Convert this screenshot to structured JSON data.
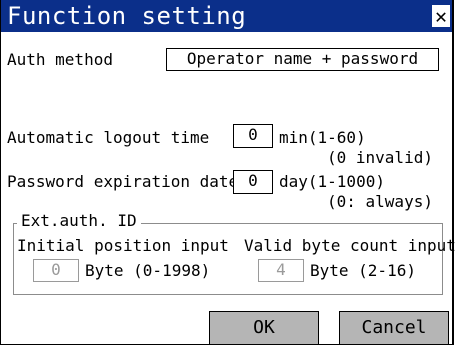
{
  "window": {
    "title": "Function setting",
    "close_glyph": "✕"
  },
  "auth": {
    "label": "Auth method",
    "value": "Operator name + password"
  },
  "logout": {
    "label": "Automatic logout time",
    "value": "0",
    "unit": "min(1-60)",
    "hint": "(0 invalid)"
  },
  "password": {
    "label": "Password expiration date",
    "value": "0",
    "unit": "day(1-1000)",
    "hint": "(0: always)"
  },
  "ext_auth": {
    "group_label": "Ext.auth. ID",
    "initial_label": "Initial position input",
    "initial_value": "0",
    "initial_unit": "Byte (0-1998)",
    "count_label": "Valid byte count input",
    "count_value": "4",
    "count_unit": "Byte (2-16)"
  },
  "buttons": {
    "ok": "OK",
    "cancel": "Cancel"
  },
  "colors": {
    "titlebar": "#0b2f8a",
    "button": "#b5b5b5",
    "disabled": "#9a9a9a"
  }
}
